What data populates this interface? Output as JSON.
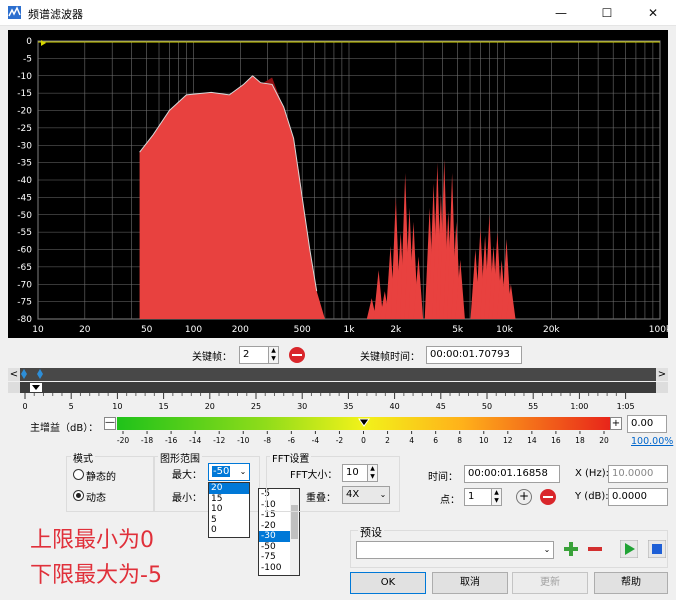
{
  "window": {
    "title": "频谱滤波器",
    "minimize": "—",
    "maximize": "☐",
    "close": "✕"
  },
  "spectrum": {
    "y_ticks": [
      "0",
      "-5",
      "-10",
      "-15",
      "-20",
      "-25",
      "-30",
      "-35",
      "-40",
      "-45",
      "-50",
      "-55",
      "-60",
      "-65",
      "-70",
      "-75",
      "-80"
    ],
    "x_ticks": [
      "10",
      "20",
      "50",
      "100",
      "200",
      "500",
      "1k",
      "2k",
      "5k",
      "10k",
      "20k",
      "100k"
    ],
    "colors": {
      "fill": "#e8413f",
      "dark": "#8f0f12",
      "grid": "#707070",
      "bg": "#000000"
    }
  },
  "keyframe": {
    "label": "关键帧：",
    "value": "2",
    "time_label": "关键帧时间：",
    "time_value": "00:00:01.70793"
  },
  "timeline": {
    "left_arrow": "<",
    "right_arrow": ">",
    "ruler": [
      "0",
      "5",
      "10",
      "15",
      "20",
      "25",
      "30",
      "35",
      "40",
      "45",
      "50",
      "55",
      "1:00",
      "1:05"
    ]
  },
  "gain": {
    "label": "主增益（dB）：",
    "minus": "—",
    "plus": "+",
    "scale": [
      "-20",
      "-18",
      "-16",
      "-14",
      "-12",
      "-10",
      "-8",
      "-6",
      "-4",
      "-2",
      "0",
      "2",
      "4",
      "6",
      "8",
      "10",
      "12",
      "14",
      "16",
      "18",
      "20"
    ],
    "value": "0.00",
    "percent": "100.00%",
    "level": 0.5
  },
  "mode": {
    "title": "模式",
    "static": "静态的",
    "dynamic": "动态",
    "selected": "dynamic"
  },
  "range": {
    "title": "图形范围",
    "max_label": "最大：",
    "max_value": "-50",
    "min_label": "最小：",
    "max_options": [
      "20",
      "15",
      "10",
      "5",
      "0"
    ],
    "min_options": [
      "-5",
      "-10",
      "-15",
      "-20",
      "-30",
      "-50",
      "-75",
      "-100"
    ],
    "min_selected": "-30"
  },
  "fft": {
    "title": "FFT设置",
    "size_label": "FFT大小：",
    "size_value": "10",
    "overlap_label": "重叠：",
    "overlap_value": "4X"
  },
  "cursor": {
    "time_label": "时间：",
    "time_value": "00:00:01.16858",
    "x_label": "X (Hz):",
    "x_value": "10.0000",
    "point_label": "点：",
    "point_value": "1",
    "y_label": "Y (dB):",
    "y_value": "0.0000"
  },
  "preset": {
    "title": "预设",
    "value": ""
  },
  "annotation": {
    "line1": "上限最小为0",
    "line2": "下限最大为-5"
  },
  "buttons": {
    "ok": "OK",
    "cancel": "取消",
    "update": "更新",
    "help": "帮助"
  }
}
